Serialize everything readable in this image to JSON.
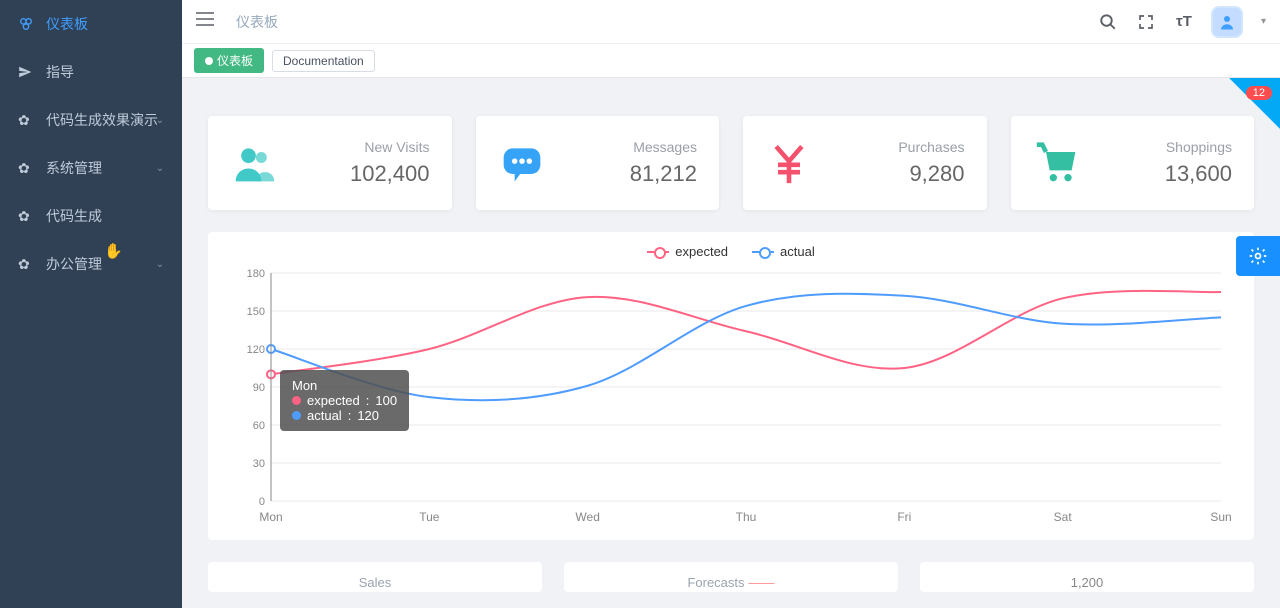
{
  "sidebar": {
    "items": [
      {
        "label": "仪表板",
        "active": true
      },
      {
        "label": "指导"
      },
      {
        "label": "代码生成效果演示",
        "arrow": true
      },
      {
        "label": "系统管理",
        "arrow": true
      },
      {
        "label": "代码生成"
      },
      {
        "label": "办公管理",
        "arrow": true
      }
    ]
  },
  "header": {
    "breadcrumb": "仪表板"
  },
  "tabs": [
    {
      "label": "仪表板",
      "active": true
    },
    {
      "label": "Documentation"
    }
  ],
  "corner_badge": "12",
  "cards": [
    {
      "title": "New Visits",
      "value": "102,400",
      "icon": "people",
      "color": "#40c9c6"
    },
    {
      "title": "Messages",
      "value": "81,212",
      "icon": "message",
      "color": "#36a3f7"
    },
    {
      "title": "Purchases",
      "value": "9,280",
      "icon": "rmb",
      "color": "#f4516c"
    },
    {
      "title": "Shoppings",
      "value": "13,600",
      "icon": "cart",
      "color": "#34bfa3"
    }
  ],
  "chart_data": {
    "type": "line",
    "legend": [
      "expected",
      "actual"
    ],
    "categories": [
      "Mon",
      "Tue",
      "Wed",
      "Thu",
      "Fri",
      "Sat",
      "Sun"
    ],
    "series": [
      {
        "name": "expected",
        "values": [
          100,
          120,
          161,
          134,
          105,
          160,
          165
        ],
        "color": "#ff6384"
      },
      {
        "name": "actual",
        "values": [
          120,
          82,
          91,
          154,
          162,
          140,
          145
        ],
        "color": "#4f9cff"
      }
    ],
    "ylim": [
      0,
      180
    ],
    "yticks": [
      0,
      30,
      60,
      90,
      120,
      150,
      180
    ]
  },
  "tooltip": {
    "title": "Mon",
    "rows": [
      {
        "name": "expected",
        "value": 100,
        "color": "#ff6384"
      },
      {
        "name": "actual",
        "value": 120,
        "color": "#4f9cff"
      }
    ]
  },
  "panels": {
    "sales": "Sales",
    "forecasts": "Forecasts",
    "barvalue": "1,200"
  }
}
